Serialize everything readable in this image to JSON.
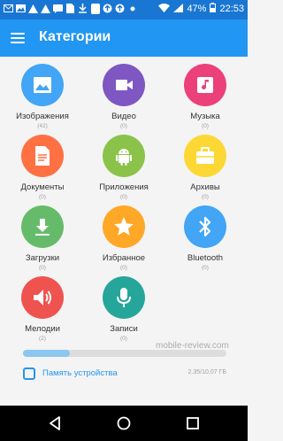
{
  "status": {
    "battery": "47%",
    "time": "22:53"
  },
  "appbar": {
    "title": "Категории"
  },
  "colors": {
    "statusbar": "#1976d2",
    "appbar": "#2196f3",
    "images": "#42a5f5",
    "video": "#7e57c2",
    "music": "#ec407a",
    "docs": "#ff7043",
    "apps": "#8bc34a",
    "archives": "#fdd835",
    "downloads": "#66bb6a",
    "favorites": "#ffa726",
    "bluetooth": "#42a5f5",
    "ringtones": "#ef5350",
    "recordings": "#26a69a"
  },
  "categories": [
    {
      "label": "Изображения",
      "count": "(42)",
      "icon": "image-icon"
    },
    {
      "label": "Видео",
      "count": "(0)",
      "icon": "video-camera-icon"
    },
    {
      "label": "Музыка",
      "count": "(0)",
      "icon": "music-note-icon"
    },
    {
      "label": "Документы",
      "count": "(0)",
      "icon": "document-icon"
    },
    {
      "label": "Приложения",
      "count": "(0)",
      "icon": "android-icon"
    },
    {
      "label": "Архивы",
      "count": "(0)",
      "icon": "briefcase-icon"
    },
    {
      "label": "Загрузки",
      "count": "(0)",
      "icon": "download-icon"
    },
    {
      "label": "Избранное",
      "count": "(0)",
      "icon": "star-icon"
    },
    {
      "label": "Bluetooth",
      "count": "(0)",
      "icon": "bluetooth-icon"
    },
    {
      "label": "Мелодии",
      "count": "(2)",
      "icon": "speaker-icon"
    },
    {
      "label": "Записи",
      "count": "(0)",
      "icon": "microphone-icon"
    }
  ],
  "storage": {
    "label": "Память устройства",
    "size": "2.35/10.07 ГБ",
    "used_fraction": 0.23
  },
  "watermark": "mobile-review.com"
}
